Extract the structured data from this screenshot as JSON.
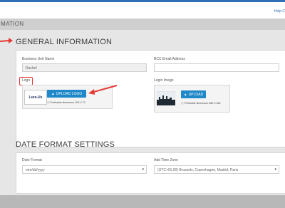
{
  "header": {
    "help_label": "Help C"
  },
  "title_bar": {
    "text": "MATION"
  },
  "general": {
    "title": "GENERAL INFORMATION",
    "business_unit_label": "Business Unit Name",
    "business_unit_value": "Rachel",
    "bcc_label": "BCC Email Address",
    "bcc_value": "",
    "logo_label": "Logo",
    "logo_button": "UPLOAD LOGO",
    "logo_hint": "Preferable dimension: 200 X 70",
    "logo_thumb_text": "Lure-Us",
    "login_image_label": "Login Image",
    "login_button": "UPLOAD",
    "login_hint": "Preferable dimension: 880 X 660"
  },
  "date_format": {
    "title": "DATE FORMAT SETTINGS",
    "date_format_label": "Date Format",
    "date_format_value": "mm/dd/yyyy",
    "time_zone_label": "Add Time Zone",
    "time_zone_value": "(UTC+01:00) Brussels, Copenhagen, Madrid, Paris"
  },
  "colors": {
    "accent": "#1e88c8",
    "annotation": "#e53935",
    "top_bar": "#2f6fb5"
  }
}
